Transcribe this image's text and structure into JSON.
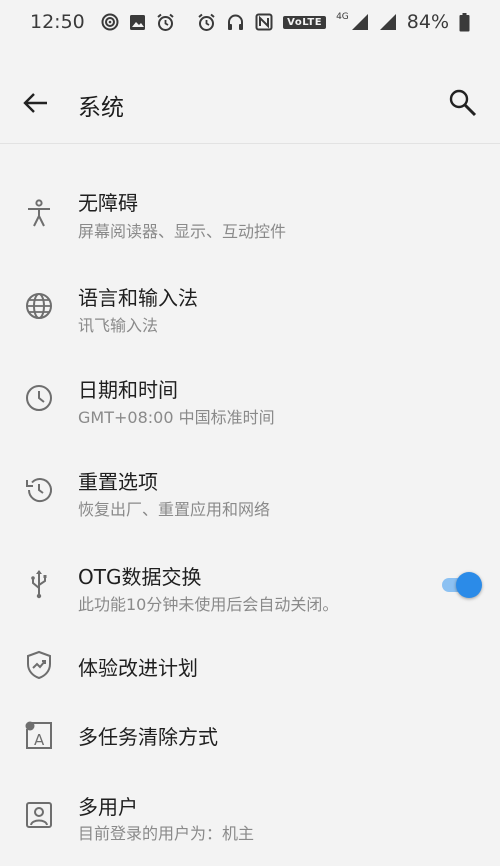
{
  "status_bar": {
    "time": "12:50",
    "volte": "VoLTE",
    "network": "4G",
    "battery": "84%"
  },
  "header": {
    "title": "系统",
    "back_icon": "arrow-left-icon",
    "search_icon": "search-icon"
  },
  "items": [
    {
      "title": "无障碍",
      "subtitle": "屏幕阅读器、显示、互动控件",
      "icon": "accessibility-icon"
    },
    {
      "title": "语言和输入法",
      "subtitle": "讯飞输入法",
      "icon": "globe-icon"
    },
    {
      "title": "日期和时间",
      "subtitle": "GMT+08:00 中国标准时间",
      "icon": "clock-icon"
    },
    {
      "title": "重置选项",
      "subtitle": "恢复出厂、重置应用和网络",
      "icon": "history-icon"
    },
    {
      "title": "OTG数据交换",
      "subtitle": "此功能10分钟未使用后会自动关闭。",
      "icon": "usb-icon",
      "toggle_on": true
    },
    {
      "title": "体验改进计划",
      "icon": "shield-chart-icon"
    },
    {
      "title": "多任务清除方式",
      "icon": "clear-mode-icon"
    },
    {
      "title": "多用户",
      "subtitle": "目前登录的用户为：机主",
      "icon": "user-icon"
    }
  ],
  "colors": {
    "accent": "#2b8be8",
    "track": "#8cc1f2",
    "background": "#f3f3f3"
  }
}
